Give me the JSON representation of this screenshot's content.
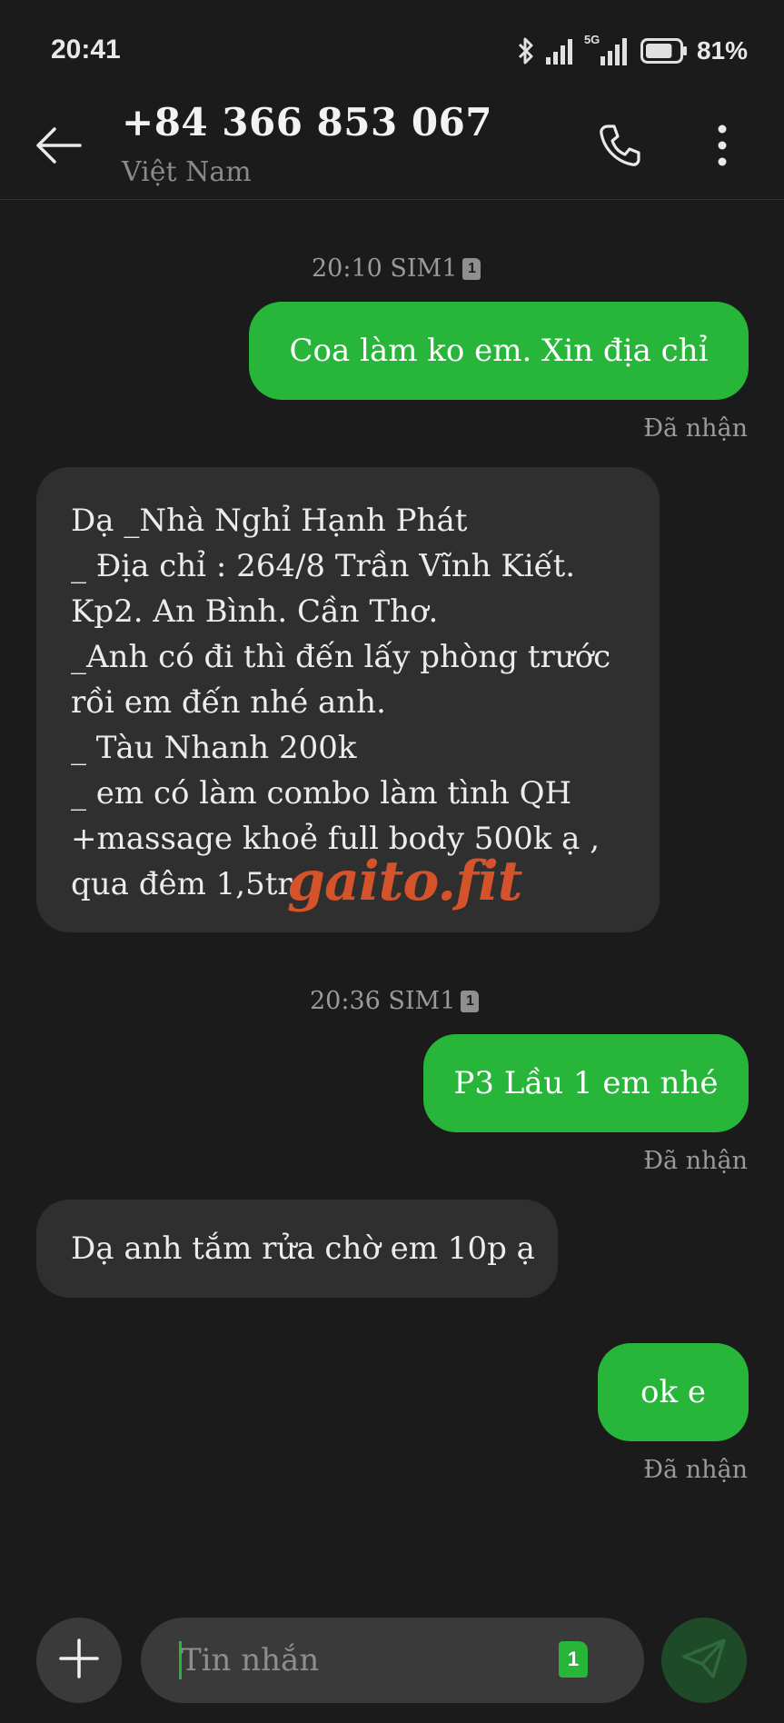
{
  "status_bar": {
    "time": "20:41",
    "network_label": "5G",
    "battery_percent": "81%",
    "battery_level": 0.81
  },
  "header": {
    "contact_number": "+84 366 853 067",
    "contact_country": "Việt Nam",
    "icons": [
      "arrow-left-icon",
      "phone-icon",
      "more-vertical-icon"
    ]
  },
  "conversation": {
    "groups": [
      {
        "time": "20:10 SIM1",
        "sim": "1"
      },
      {
        "time": "20:36 SIM1",
        "sim": "1"
      }
    ],
    "messages": [
      {
        "direction": "out",
        "text": "Coa làm ko em. Xin địa chỉ",
        "status": "Đã nhận"
      },
      {
        "direction": "in",
        "lines": [
          "Dạ _Nhà Nghỉ Hạnh Phát",
          "_ Địa chỉ : 264/8 Trần Vĩnh Kiết.",
          "Kp2. An Bình. Cần Thơ.",
          "_Anh có đi thì đến lấy phòng trước",
          "rồi em đến nhé anh.",
          "_ Tàu Nhanh 200k",
          "_ em có làm combo làm tình QH",
          "+massage khoẻ full body 500k ạ ,",
          "qua đêm 1,5tr"
        ]
      },
      {
        "direction": "out",
        "text": "P3 Lầu 1 em nhé",
        "status": "Đã nhận"
      },
      {
        "direction": "in",
        "lines": [
          "Dạ anh tắm rửa chờ em 10p ạ"
        ]
      },
      {
        "direction": "out",
        "text": "ok e",
        "status": "Đã nhận"
      }
    ],
    "watermark": "gaito.fit"
  },
  "composer": {
    "placeholder": "Tin nhắn",
    "sim_selected": "1",
    "icons": [
      "plus-icon",
      "send-icon"
    ]
  },
  "colors": {
    "background": "#1b1b1b",
    "outgoing_bubble": "#27b53a",
    "incoming_bubble": "#2f2f2f",
    "secondary_text": "#9a9a9a",
    "watermark": "#d4532a"
  }
}
